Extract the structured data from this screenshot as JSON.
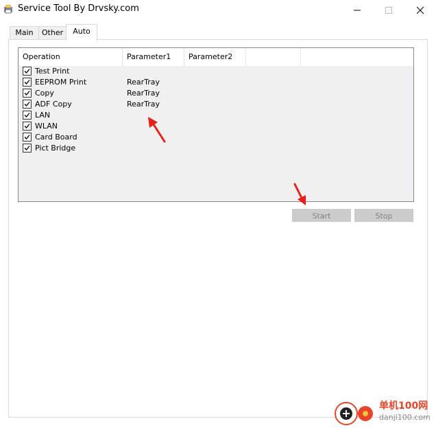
{
  "window": {
    "title": "Service Tool By Drvsky.com"
  },
  "tabs": [
    {
      "label": "Main"
    },
    {
      "label": "Other"
    },
    {
      "label": "Auto"
    }
  ],
  "list": {
    "columns": [
      "Operation",
      "Parameter1",
      "Parameter2"
    ],
    "rows": [
      {
        "label": "Test Print",
        "param1": "",
        "checked": true
      },
      {
        "label": "EEPROM Print",
        "param1": "RearTray",
        "checked": true
      },
      {
        "label": "Copy",
        "param1": "RearTray",
        "checked": true
      },
      {
        "label": "ADF Copy",
        "param1": "RearTray",
        "checked": true
      },
      {
        "label": "LAN",
        "param1": "",
        "checked": true
      },
      {
        "label": "WLAN",
        "param1": "",
        "checked": true
      },
      {
        "label": "Card Board",
        "param1": "",
        "checked": true
      },
      {
        "label": "Pict Bridge",
        "param1": "",
        "checked": true
      }
    ]
  },
  "buttons": {
    "start": "Start",
    "stop": "Stop"
  },
  "watermark": {
    "brand": "单机100网",
    "url": "danji100.com"
  },
  "colors": {
    "annotation_arrow": "#e8201a",
    "disabled_button": "#cccccc",
    "list_background": "#f0f0f0"
  }
}
